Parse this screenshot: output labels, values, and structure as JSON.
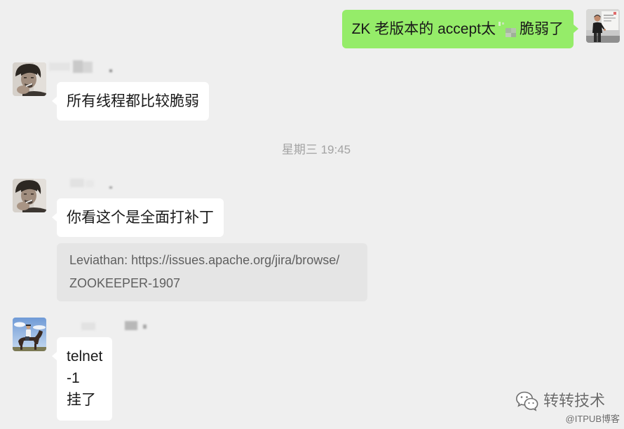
{
  "colors": {
    "background": "#efefef",
    "bubble_self": "#95ec69",
    "bubble_other": "#ffffff",
    "link_card": "#e5e5e5",
    "timestamp": "#a3a3a3",
    "message_text": "#191919",
    "link_text": "#5f5f5f"
  },
  "messages": {
    "outgoing_1": {
      "avatar_icon": "self-avatar",
      "text_before": "ZK 老版本的 accept太",
      "text_after": "脆弱了"
    },
    "incoming_1": {
      "avatar_icon": "smoking-man-avatar",
      "text": "所有线程都比较脆弱"
    },
    "timestamp": "星期三 19:45",
    "incoming_2": {
      "avatar_icon": "smoking-man-avatar",
      "text": "你看这个是全面打补丁"
    },
    "incoming_2_link": {
      "lines": [
        "Leviathan: https://issues.apache.org/jira/browse/",
        "ZOOKEEPER-1907"
      ]
    },
    "incoming_3": {
      "avatar_icon": "horse-rider-avatar",
      "lines": [
        "telnet",
        "-1",
        "挂了"
      ]
    }
  },
  "watermark": {
    "icon": "wechat-icon",
    "brand": "转转技术",
    "source": "@ITPUB博客"
  }
}
